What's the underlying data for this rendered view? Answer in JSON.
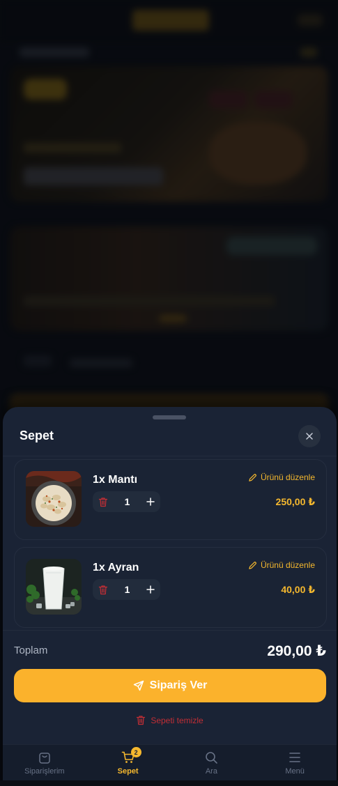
{
  "cart": {
    "title": "Sepet",
    "items": [
      {
        "name": "1x Mantı",
        "edit_label": "Ürünü düzenle",
        "quantity": "1",
        "price": "250,00 ₺",
        "image": "manti-dish"
      },
      {
        "name": "1x Ayran",
        "edit_label": "Ürünü düzenle",
        "quantity": "1",
        "price": "40,00 ₺",
        "image": "ayran-glass"
      }
    ],
    "total_label": "Toplam",
    "total_value": "290,00 ₺",
    "order_button": "Sipariş Ver",
    "clear_label": "Sepeti temizle"
  },
  "nav": {
    "items": [
      {
        "label": "Siparişlerim",
        "icon": "shopping-bag-icon"
      },
      {
        "label": "Sepet",
        "icon": "cart-icon",
        "badge": "2"
      },
      {
        "label": "Ara",
        "icon": "search-icon"
      },
      {
        "label": "Menü",
        "icon": "menu-icon"
      }
    ]
  },
  "colors": {
    "accent": "#fbb22c",
    "sheet_bg": "#1a2335",
    "danger": "#c22e35"
  }
}
